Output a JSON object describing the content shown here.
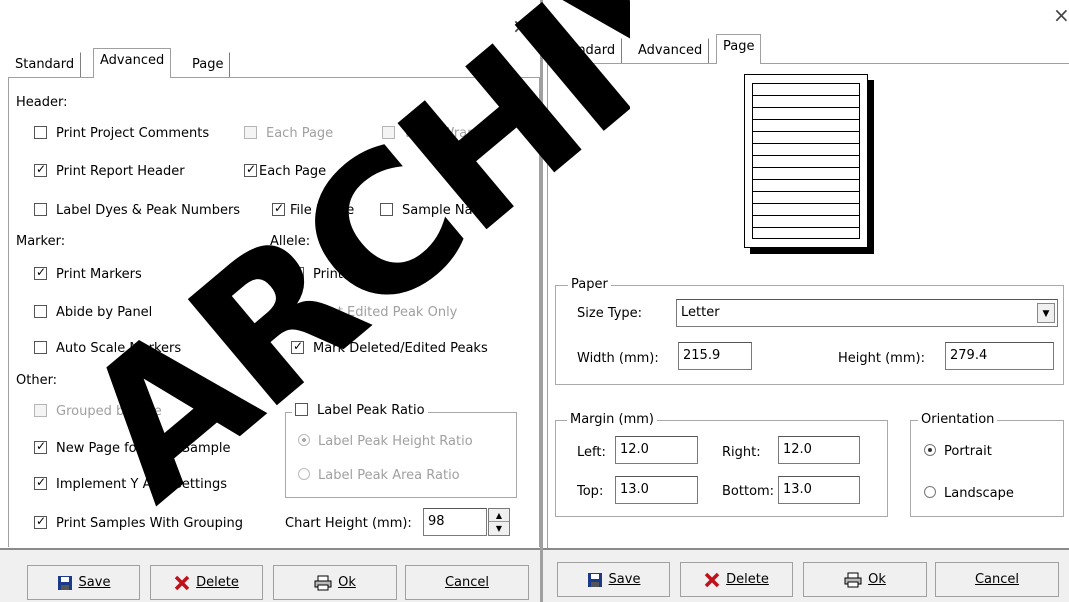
{
  "close_glyph": "×",
  "watermark": "ARCHIVED",
  "left": {
    "tabs": [
      "Standard",
      "Advanced",
      "Page"
    ],
    "header_label": "Header:",
    "print_project_comments": "Print Project Comments",
    "each_page_1": "Each Page",
    "word_wrap": "Word Wrap",
    "print_report_header": "Print Report Header",
    "each_page_2": "Each Page",
    "label_dyes": "Label Dyes & Peak Numbers",
    "file_name": "File Name",
    "sample_name": "Sample Name",
    "marker_label": "Marker:",
    "allele_label": "Allele:",
    "print_markers": "Print Markers",
    "print_alleles": "Print Alleles",
    "abide_by_panel": "Abide by Panel",
    "print_edited_peak_only": "Print Edited Peak Only",
    "auto_scale_markers": "Auto Scale Markers",
    "mark_deleted": "Mark Deleted/Edited Peaks",
    "other_label": "Other:",
    "grouped_by_dye": "Grouped by Dye",
    "label_peak_ratio": "Label Peak Ratio",
    "new_page": "New Page for Each Sample",
    "height_ratio": "Label Peak Height Ratio",
    "implement_y": "Implement  Y Axis Settings",
    "area_ratio": "Label Peak Area Ratio",
    "print_samples_grouping": "Print Samples With Grouping",
    "chart_height_label": "Chart Height (mm):",
    "chart_height_value": "98"
  },
  "right": {
    "tabs": [
      "Standard",
      "Advanced",
      "Page"
    ],
    "paper_label": "Paper",
    "size_type_label": "Size Type:",
    "size_type_value": "Letter",
    "width_label": "Width (mm):",
    "width_value": "215.9",
    "height_label": "Height (mm):",
    "height_value": "279.4",
    "margin_label": "Margin (mm)",
    "left_label": "Left:",
    "left_value": "12.0",
    "right_label": "Right:",
    "right_value": "12.0",
    "top_label": "Top:",
    "top_value": "13.0",
    "bottom_label": "Bottom:",
    "bottom_value": "13.0",
    "orientation_label": "Orientation",
    "portrait": "Portrait",
    "landscape": "Landscape"
  },
  "buttons": {
    "save": "Save",
    "delete": "Delete",
    "ok": "Ok",
    "cancel": "Cancel"
  }
}
